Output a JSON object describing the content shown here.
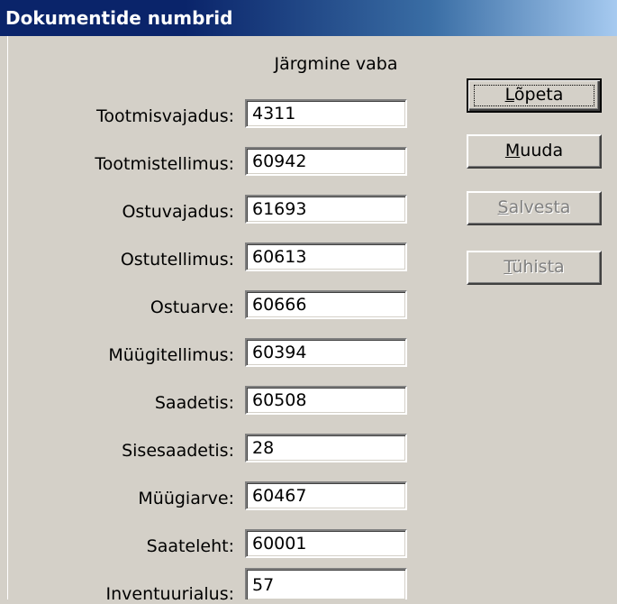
{
  "window": {
    "title": "Dokumentide numbrid"
  },
  "header": {
    "column_label": "Järgmine vaba"
  },
  "rows": [
    {
      "label": "Tootmisvajadus:",
      "value": "4311"
    },
    {
      "label": "Tootmistellimus:",
      "value": "60942"
    },
    {
      "label": "Ostuvajadus:",
      "value": "61693"
    },
    {
      "label": "Ostutellimus:",
      "value": "60613"
    },
    {
      "label": "Ostuarve:",
      "value": "60666"
    },
    {
      "label": "Müügitellimus:",
      "value": "60394"
    },
    {
      "label": "Saadetis:",
      "value": "60508"
    },
    {
      "label": "Sisesaadetis:",
      "value": "28"
    },
    {
      "label": "Müügiarve:",
      "value": "60467"
    },
    {
      "label": "Saateleht:",
      "value": "60001"
    },
    {
      "label": "Inventuurialus:",
      "value": "57"
    }
  ],
  "buttons": {
    "lopeta": {
      "mnemonic": "L",
      "rest": "õpeta"
    },
    "muuda": {
      "mnemonic": "M",
      "rest": "uuda"
    },
    "salvesta": {
      "mnemonic": "S",
      "rest": "alvesta"
    },
    "tuhista": {
      "mnemonic": "T",
      "rest": "ühista"
    }
  }
}
